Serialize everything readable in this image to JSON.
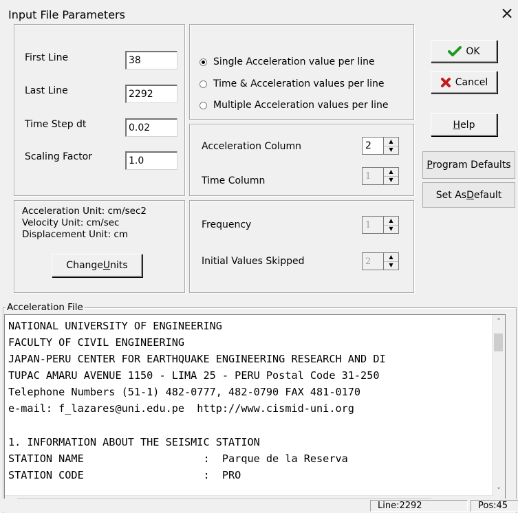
{
  "window": {
    "title": "Input File Parameters",
    "close_symbol": "×"
  },
  "fields": {
    "first_line": {
      "label": "First Line",
      "value": "38"
    },
    "last_line": {
      "label": "Last Line",
      "value": "2292"
    },
    "time_step": {
      "label": "Time Step dt",
      "value": "0.02"
    },
    "scaling_factor": {
      "label": "Scaling Factor",
      "value": "1.0"
    }
  },
  "format_options": {
    "selected_index": 0,
    "items": [
      "Single Acceleration value per line",
      "Time & Acceleration values per line",
      "Multiple Acceleration values per line"
    ]
  },
  "columns": {
    "acceleration_column": {
      "label": "Acceleration Column",
      "value": "2",
      "enabled": true
    },
    "time_column": {
      "label": "Time Column",
      "value": "1",
      "enabled": false
    }
  },
  "units": {
    "acceleration": "Acceleration Unit: cm/sec2",
    "velocity": "Velocity Unit: cm/sec",
    "displacement": "Displacement Unit: cm",
    "change_button_pre": "Change ",
    "change_button_u": "U",
    "change_button_post": "nits"
  },
  "sampling": {
    "frequency": {
      "label": "Frequency",
      "value": "1",
      "enabled": false
    },
    "initial_values_skipped": {
      "label": "Initial Values Skipped",
      "value": "2",
      "enabled": false
    }
  },
  "buttons": {
    "ok": "OK",
    "cancel": "Cancel",
    "help_u": "H",
    "help_rest": "elp",
    "program_defaults_u": "P",
    "program_defaults_rest": "rogram Defaults",
    "set_default_pre": "Set As ",
    "set_default_u": "D",
    "set_default_post": "efault"
  },
  "acceleration_file": {
    "legend": "Acceleration File",
    "lines": [
      "NATIONAL UNIVERSITY OF ENGINEERING",
      "FACULTY OF CIVIL ENGINEERING",
      "JAPAN-PERU CENTER FOR EARTHQUAKE ENGINEERING RESEARCH AND DI",
      "TUPAC AMARU AVENUE 1150 - LIMA 25 - PERU Postal Code 31-250",
      "Telephone Numbers (51-1) 482-0777, 482-0790 FAX 481-0170",
      "e-mail: f_lazares@uni.edu.pe  http://www.cismid-uni.org",
      "",
      "1. INFORMATION ABOUT THE SEISMIC STATION",
      "STATION NAME                   :  Parque de la Reserva",
      "STATION CODE                   :  PRO"
    ]
  },
  "status": {
    "line": "Line:2292",
    "pos": "Pos:45"
  },
  "colors": {
    "ok_check": "#1f9a1f",
    "cancel_x": "#c41a1a",
    "window_bg": "#f0f0f0"
  }
}
